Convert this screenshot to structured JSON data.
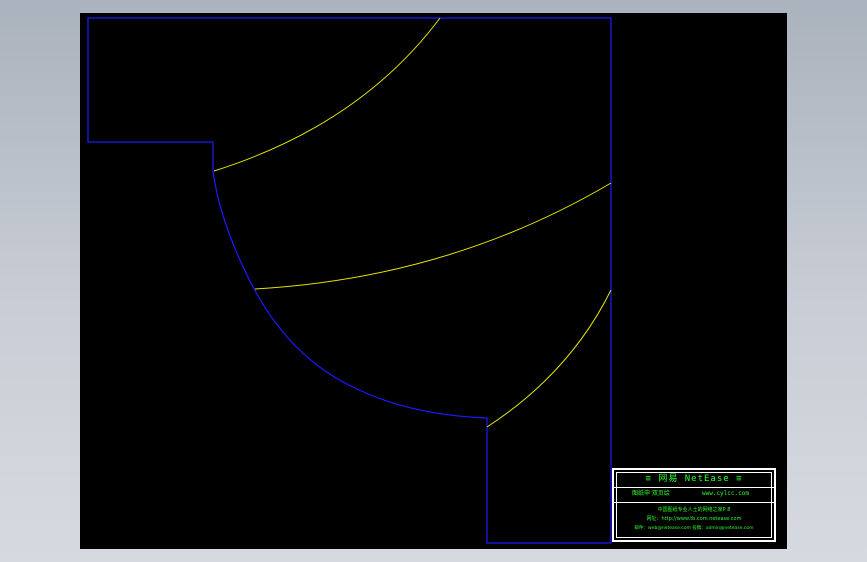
{
  "drawing": {
    "background": "#000000",
    "outline_color": "#1a1aff",
    "curve_color": "#e6e600"
  },
  "title_block": {
    "brand": "≡ 网易 NetEase ≡",
    "row2_left": "图纸申 双页绘",
    "row2_right": "www.cylcc.com",
    "row3": "中国图纸专业人士的网络之家P 8",
    "row4": "网址：http://www.tb.com.netease.com",
    "row5": "邮件：web@netease.com   投稿：admin@netease.com",
    "text_color": "#2aff2a",
    "border_color": "#ffffff"
  }
}
